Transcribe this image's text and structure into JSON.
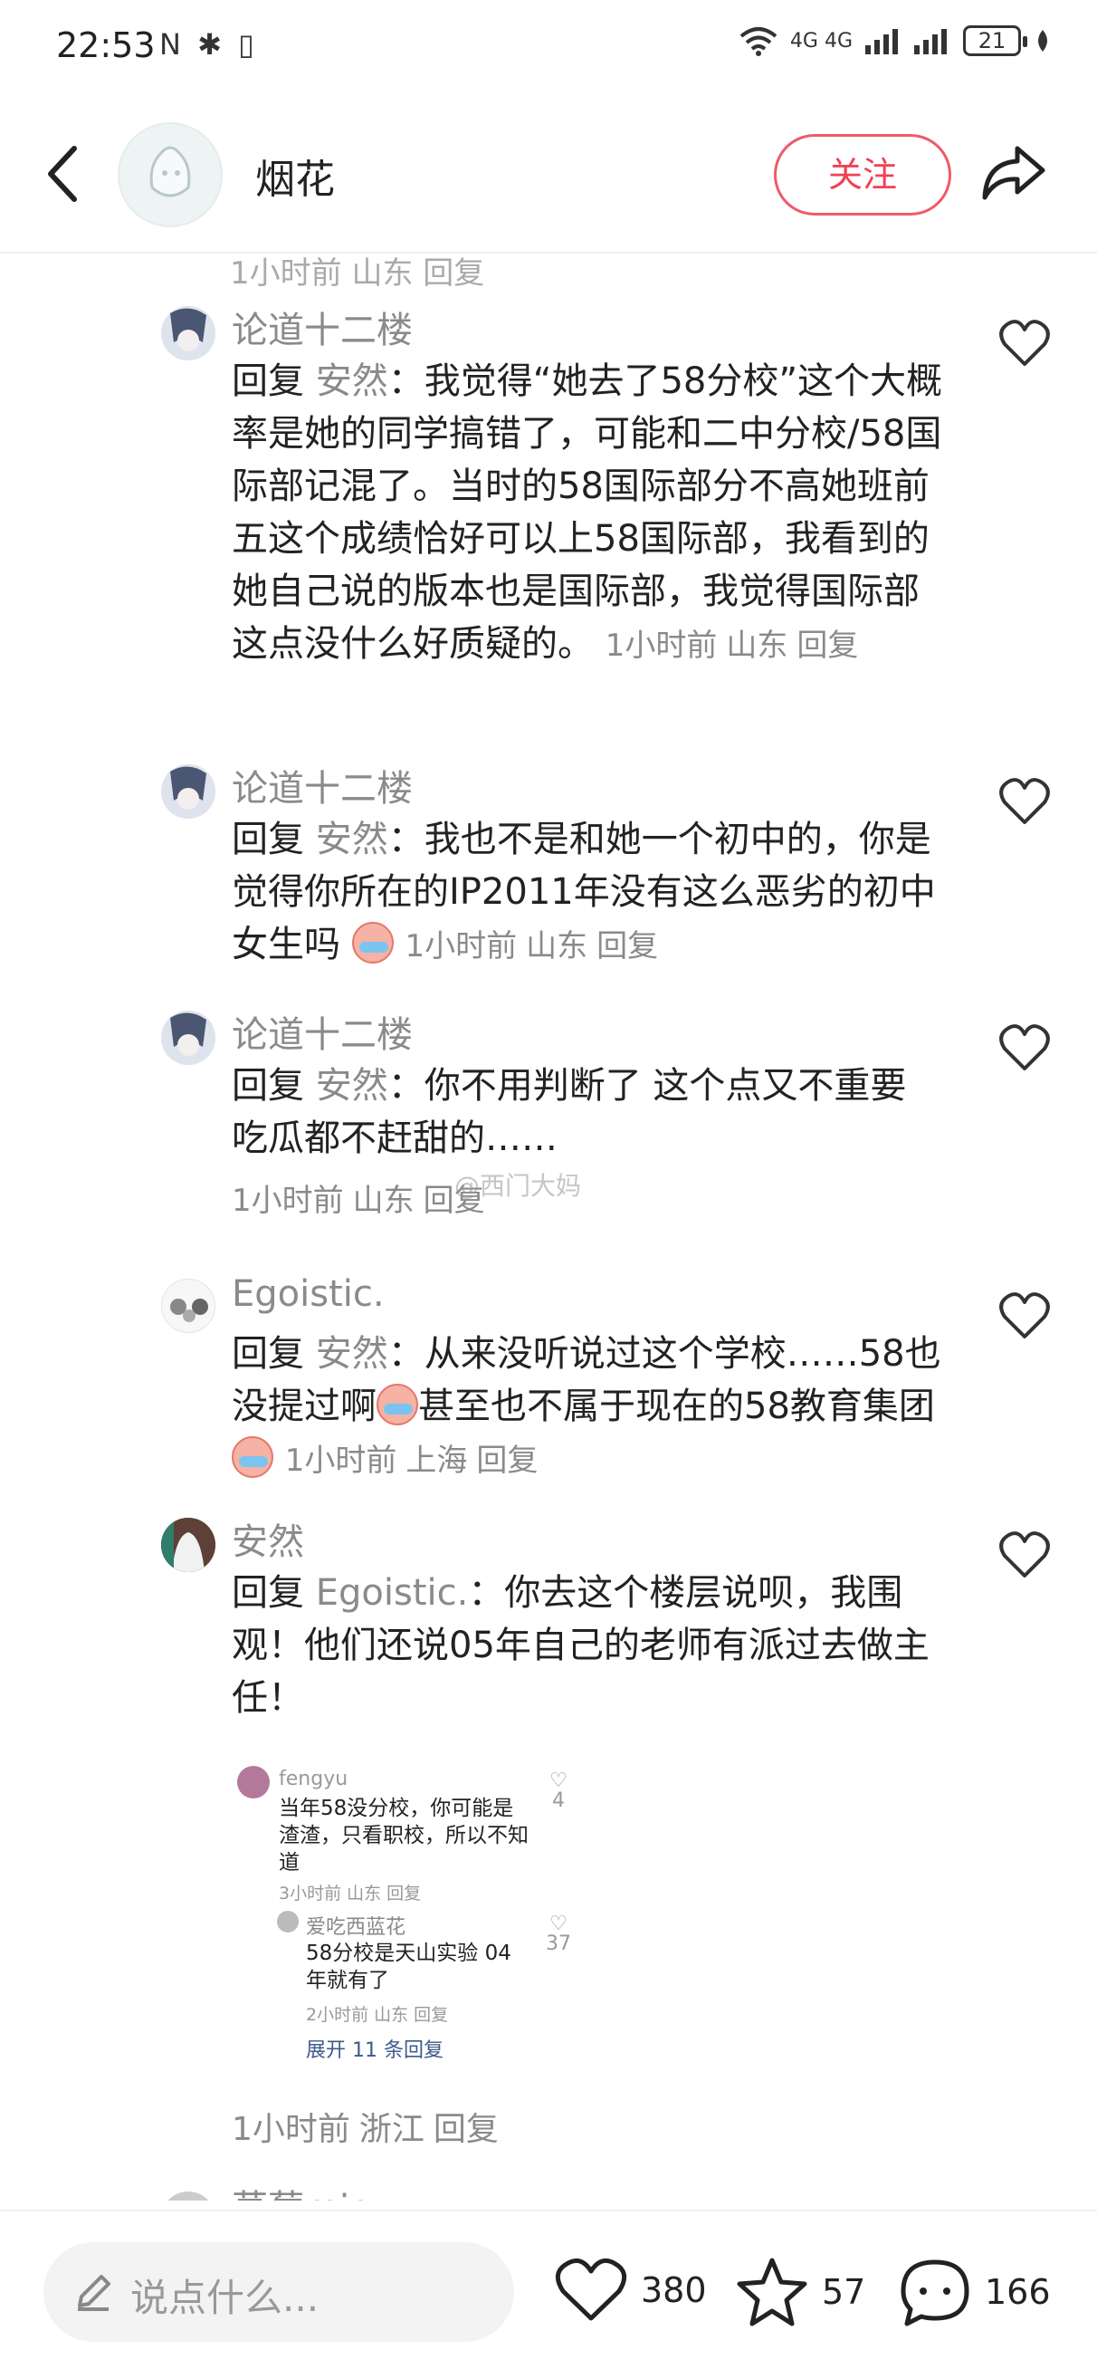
{
  "status_bar": {
    "time": "22:53",
    "system_icons": "N ✱ ▯",
    "network": "4G 4G",
    "battery": "21"
  },
  "header": {
    "title": "烟花",
    "follow_label": "关注"
  },
  "comments": [
    {
      "user": "论道十二楼",
      "reply_word": "回复",
      "reply_target": "安然",
      "text": "：我觉得“她去了58分校”这个大概率是她的同学搞错了，可能和二中分校/58国际部记混了。当时的58国际部分不高她班前五这个成绩恰好可以上58国际部，我看到的她自己说的版本也是国际部，我觉得国际部这点没什么好质疑的。",
      "time": "1小时前",
      "location": "山东",
      "reply_action": "回复"
    },
    {
      "user": "论道十二楼",
      "reply_word": "回复",
      "reply_target": "安然",
      "text": "：我也不是和她一个初中的，你是觉得你所在的IP2011年没有这么恶劣的初中女生吗",
      "time": "1小时前",
      "location": "山东",
      "reply_action": "回复"
    },
    {
      "user": "论道十二楼",
      "reply_word": "回复",
      "reply_target": "安然",
      "text": "：你不用判断了 这个点又不重要 吃瓜都不赶甜的……",
      "time": "1小时前",
      "location": "山东",
      "reply_action": "回复"
    },
    {
      "user": "Egoistic.",
      "reply_word": "回复",
      "reply_target": "安然",
      "text_a": "：从来没听说过这个学校……58也没提过啊",
      "text_b": "甚至也不属于现在的58教育集团",
      "time": "1小时前",
      "location": "上海",
      "reply_action": "回复"
    },
    {
      "user": "安然",
      "reply_word": "回复",
      "reply_target": "Egoistic.",
      "text": "：你去这个楼层说呗，我围观！他们还说05年自己的老师有派过去做主任！",
      "time": "1小时前",
      "location": "浙江",
      "reply_action": "回复"
    }
  ],
  "embedded": {
    "first": {
      "user": "fengyu",
      "text": "当年58没分校，你可能是渣渣，只看职校，所以不知道",
      "meta": "3小时前 山东 回复",
      "likes": "4"
    },
    "second": {
      "user": "爱吃西蓝花",
      "text": "58分校是天山实验 04年就有了",
      "meta": "2小时前 山东 回复",
      "likes": "37"
    },
    "expand": "展开 11 条回复"
  },
  "partial": {
    "top_line": "1小时前 山东 回复",
    "bottom_user": "草莓mio"
  },
  "watermark": "@西门大妈",
  "bottom_bar": {
    "placeholder": "说点什么...",
    "likes": "380",
    "favorites": "57",
    "comments": "166"
  },
  "icons": {
    "back": "chevron-left-icon",
    "share": "share-arrow-icon",
    "heart": "heart-icon",
    "star": "star-icon",
    "comment": "comment-bubble-icon",
    "pencil": "pencil-icon"
  },
  "colors": {
    "accent": "#f04154",
    "muted_text": "#8a8a8a",
    "link": "#3d5a8a"
  }
}
